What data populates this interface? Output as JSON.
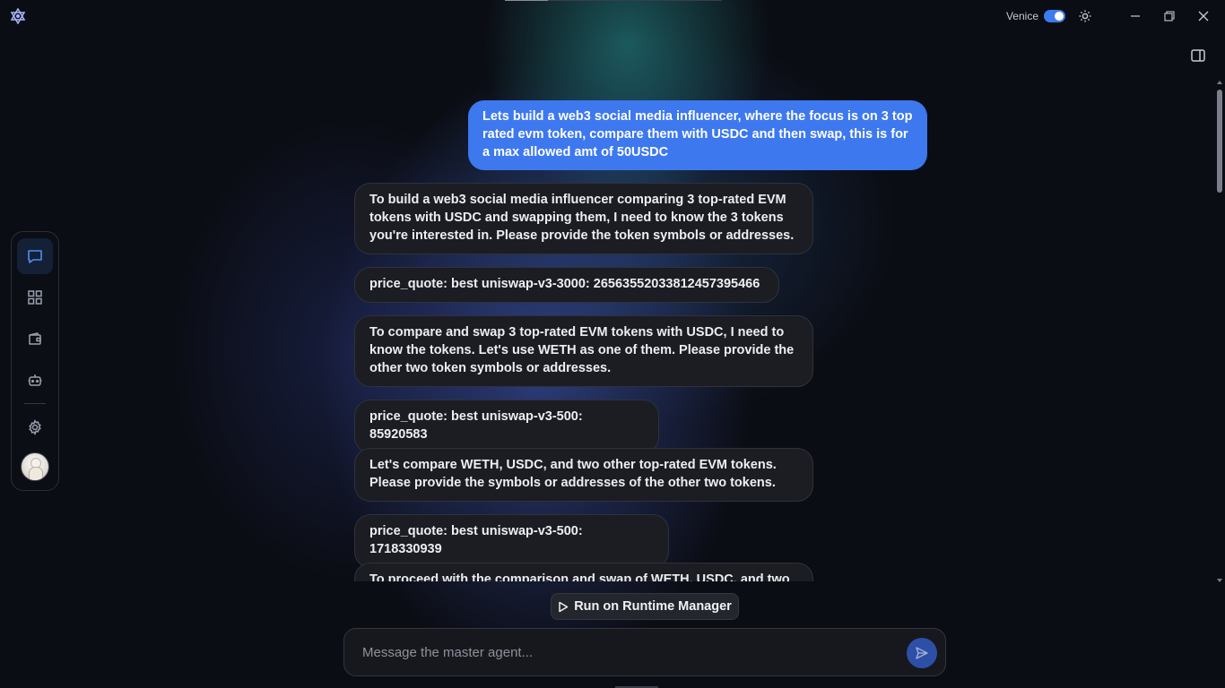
{
  "titlebar": {
    "venice_label": "Venice",
    "venice_enabled": true,
    "icons": [
      "app-logo-icon",
      "sun-icon",
      "minimize-icon",
      "restore-icon",
      "close-icon",
      "panel-toggle-icon"
    ]
  },
  "sidebar": {
    "items": [
      {
        "name": "chat",
        "icon": "chat-icon",
        "active": true
      },
      {
        "name": "apps",
        "icon": "grid-icon",
        "active": false
      },
      {
        "name": "wallet",
        "icon": "wallet-icon",
        "active": false
      },
      {
        "name": "agents",
        "icon": "robot-icon",
        "active": false
      },
      {
        "name": "settings",
        "icon": "gear-icon",
        "active": false
      }
    ],
    "avatar_icon": "avatar"
  },
  "chat": {
    "messages": [
      {
        "role": "user",
        "text": "Lets build a web3 social media influencer, where the focus is on 3 top rated evm token, compare them with USDC and then swap, this is for a max allowed amt of 50USDC"
      },
      {
        "role": "assistant",
        "text": "To build a web3 social media influencer comparing 3 top-rated EVM tokens with USDC and swapping them, I need to know the 3 tokens you're interested in. Please provide the token symbols or addresses."
      },
      {
        "role": "assistant",
        "text": "price_quote: best uniswap-v3-3000: 2656355203381245739546​6"
      },
      {
        "role": "assistant",
        "text": "To compare and swap 3 top-rated EVM tokens with USDC, I need to know the tokens. Let's use WETH as one of them. Please provide the other two token symbols or addresses."
      },
      {
        "role": "assistant",
        "text": "price_quote: best uniswap-v3-500: 85920583"
      },
      {
        "role": "assistant",
        "text": "Let's compare WETH, USDC, and two other top-rated EVM tokens. Please provide the symbols or addresses of the other two tokens."
      },
      {
        "role": "assistant",
        "text": "price_quote: best uniswap-v3-500: 1718330939"
      },
      {
        "role": "assistant",
        "text": "To proceed with the comparison and swap of WETH, USDC, and two"
      }
    ]
  },
  "actions": {
    "run_label": "Run on Runtime Manager",
    "run_icon": "play-icon"
  },
  "composer": {
    "placeholder": "Message the master agent...",
    "value": "",
    "send_icon": "send-icon"
  },
  "colors": {
    "accent": "#3d78ef",
    "background": "#0b0d14",
    "bubble": "#1b1d23"
  }
}
